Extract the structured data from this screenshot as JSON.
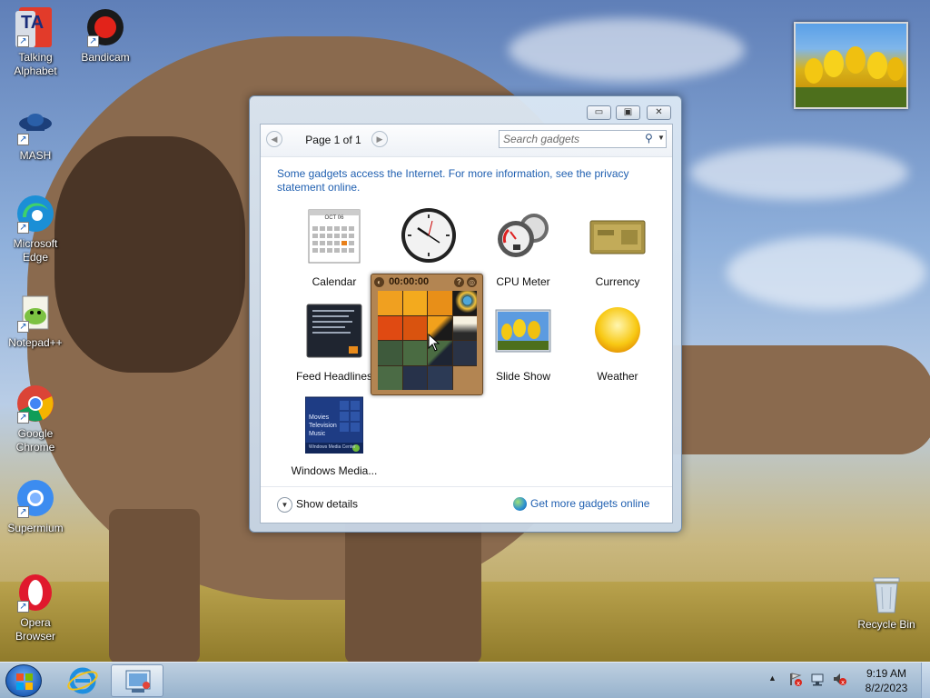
{
  "desktop": {
    "icons": [
      {
        "label": "Talking Alphabet"
      },
      {
        "label": "Bandicam"
      },
      {
        "label": "MASH"
      },
      {
        "label": "Microsoft Edge"
      },
      {
        "label": "Notepad++"
      },
      {
        "label": "Google Chrome"
      },
      {
        "label": "Supermium"
      },
      {
        "label": "Opera Browser"
      }
    ],
    "recycle_bin": "Recycle Bin",
    "talking_alphabet_glyph": "TA"
  },
  "gallery": {
    "page_indicator": "Page 1 of 1",
    "search_placeholder": "Search gadgets",
    "privacy_note": "Some gadgets access the Internet.  For more information, see the privacy statement online.",
    "gadgets": [
      {
        "label": "Calendar"
      },
      {
        "label": "Clock"
      },
      {
        "label": "CPU Meter"
      },
      {
        "label": "Currency"
      },
      {
        "label": "Feed Headlines"
      },
      {
        "label": "Picture Puzzle"
      },
      {
        "label": "Slide Show"
      },
      {
        "label": "Weather"
      },
      {
        "label": "Windows Media..."
      }
    ],
    "calendar_month": "OCT 06",
    "media_lines": [
      "Movies",
      "Television",
      "Music"
    ],
    "media_brand": "Windows Media Center",
    "puzzle_timer": "00:00:00",
    "show_details": "Show details",
    "get_more": "Get more gadgets online"
  },
  "taskbar": {
    "time": "9:19 AM",
    "date": "8/2/2023"
  },
  "colors": {
    "link": "#1f5fb0",
    "taskbar": "#a8c2e0"
  }
}
